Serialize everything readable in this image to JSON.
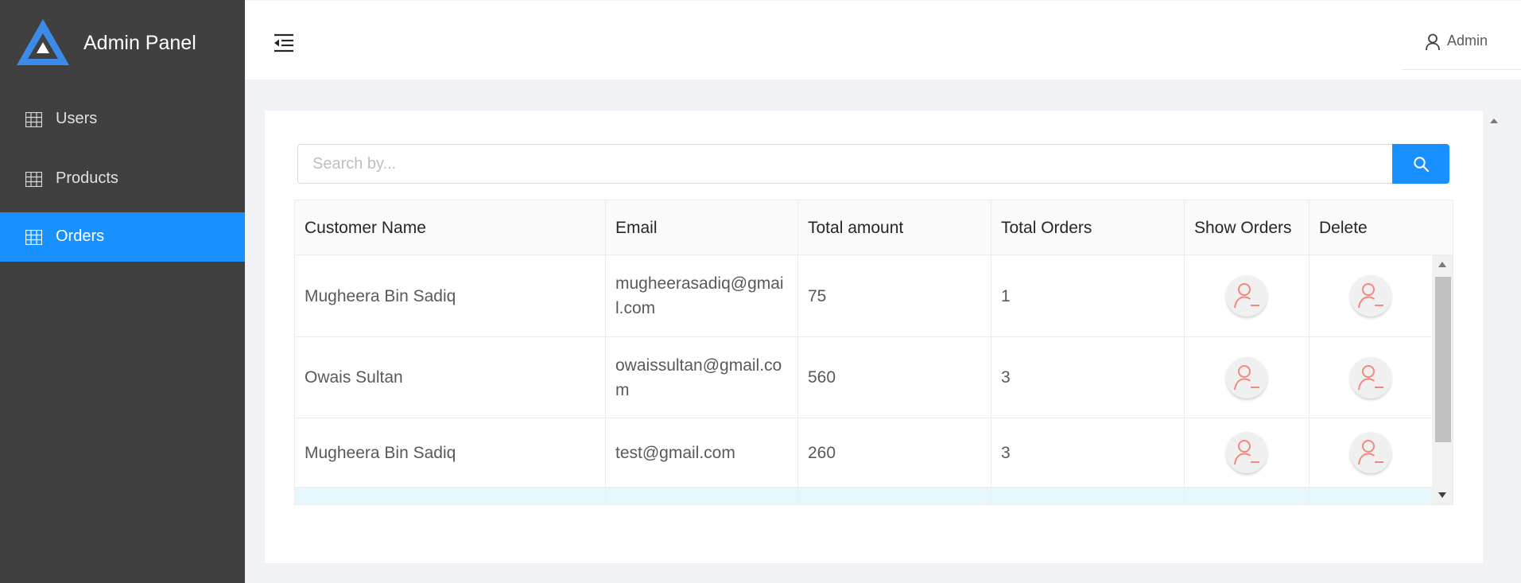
{
  "brand": {
    "title": "Admin Panel",
    "logo_icon": "triangle-logo-icon",
    "color": "#3d8be8"
  },
  "sidebar": {
    "items": [
      {
        "label": "Users",
        "icon": "table-icon",
        "active": false
      },
      {
        "label": "Products",
        "icon": "table-icon",
        "active": false
      },
      {
        "label": "Orders",
        "icon": "table-icon",
        "active": true
      }
    ],
    "background": "#404040",
    "active_color": "#1890ff"
  },
  "header": {
    "toggle_icon": "menu-fold-icon",
    "user": {
      "icon": "user-icon",
      "name": "Admin"
    }
  },
  "search": {
    "placeholder": "Search by...",
    "value": "",
    "button_icon": "search-icon"
  },
  "table": {
    "columns": [
      "Customer Name",
      "Email",
      "Total amount",
      "Total Orders",
      "Show Orders",
      "Delete"
    ],
    "rows": [
      {
        "name": "Mugheera Bin Sadiq",
        "email": "mugheerasadiq@gmail.com",
        "amount": "75",
        "orders": "1"
      },
      {
        "name": "Owais Sultan",
        "email": "owaissultan@gmail.com",
        "amount": "560",
        "orders": "3"
      },
      {
        "name": "Mugheera Bin Sadiq",
        "email": "test@gmail.com",
        "amount": "260",
        "orders": "3"
      }
    ],
    "action_icon": "user-delete-icon",
    "action_icon_color": "#f4877f"
  }
}
